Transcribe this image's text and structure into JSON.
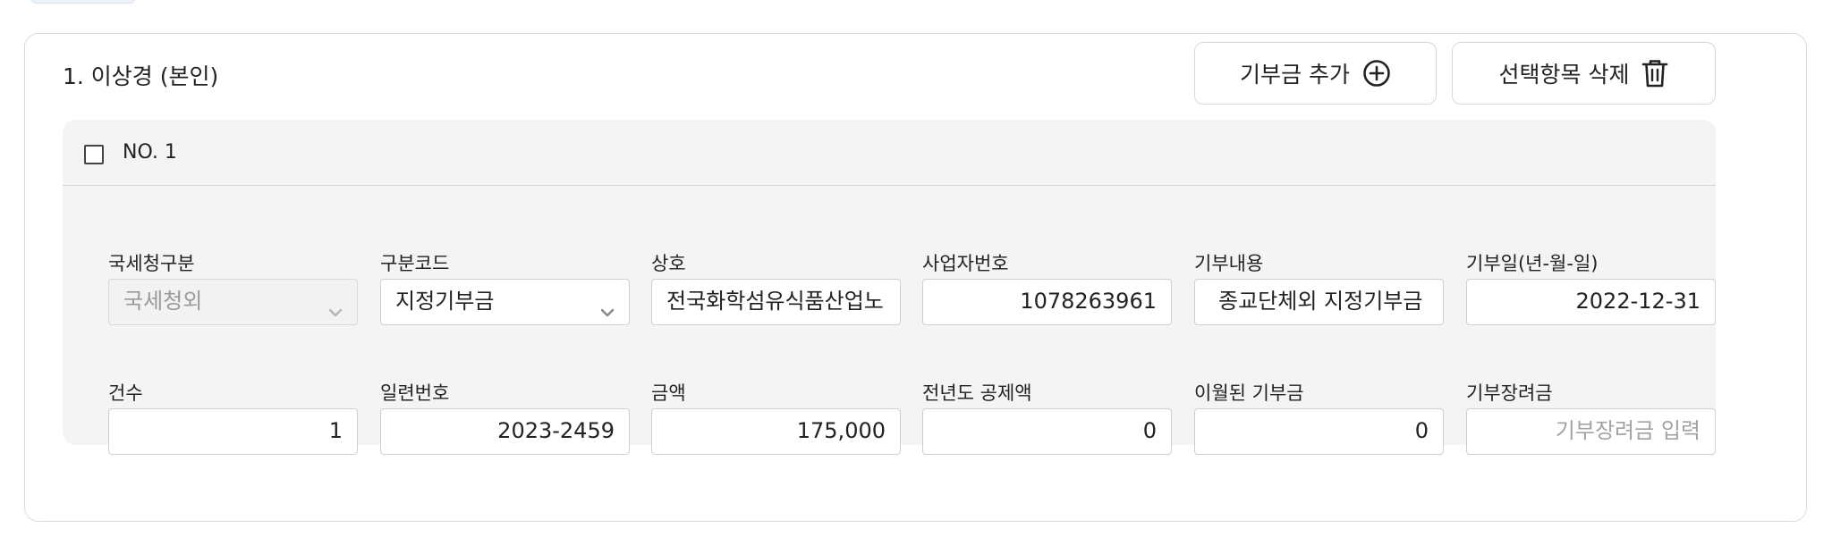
{
  "person": {
    "title": "1. 이상경 (본인)"
  },
  "toolbar": {
    "add_label": "기부금 추가",
    "delete_label": "선택항목 삭제"
  },
  "entry": {
    "no_label": "NO. 1",
    "checked": false,
    "row1": {
      "nts_category": {
        "label": "국세청구분",
        "value": "국세청외"
      },
      "category_code": {
        "label": "구분코드",
        "value": "지정기부금"
      },
      "company_name": {
        "label": "상호",
        "value": "전국화학섬유식품산업노"
      },
      "business_number": {
        "label": "사업자번호",
        "value": "1078263961"
      },
      "donation_content": {
        "label": "기부내용",
        "value": "종교단체외 지정기부금"
      },
      "donation_date": {
        "label": "기부일(년-월-일)",
        "value": "2022-12-31"
      }
    },
    "row2": {
      "count": {
        "label": "건수",
        "value": "1"
      },
      "serial_number": {
        "label": "일련번호",
        "value": "2023-2459"
      },
      "amount": {
        "label": "금액",
        "value": "175,000"
      },
      "prev_year_deduction": {
        "label": "전년도 공제액",
        "value": "0"
      },
      "carried_over": {
        "label": "이월된 기부금",
        "value": "0"
      },
      "incentive": {
        "label": "기부장려금",
        "placeholder": "기부장려금 입력"
      }
    }
  },
  "colors": {
    "border": "#dcdcdc",
    "entry_bg": "#f4f4f4",
    "placeholder": "#a3a3a3"
  },
  "icons": {
    "add": "plus-circle-icon",
    "delete": "trash-icon",
    "dropdown": "chevron-down-icon"
  }
}
